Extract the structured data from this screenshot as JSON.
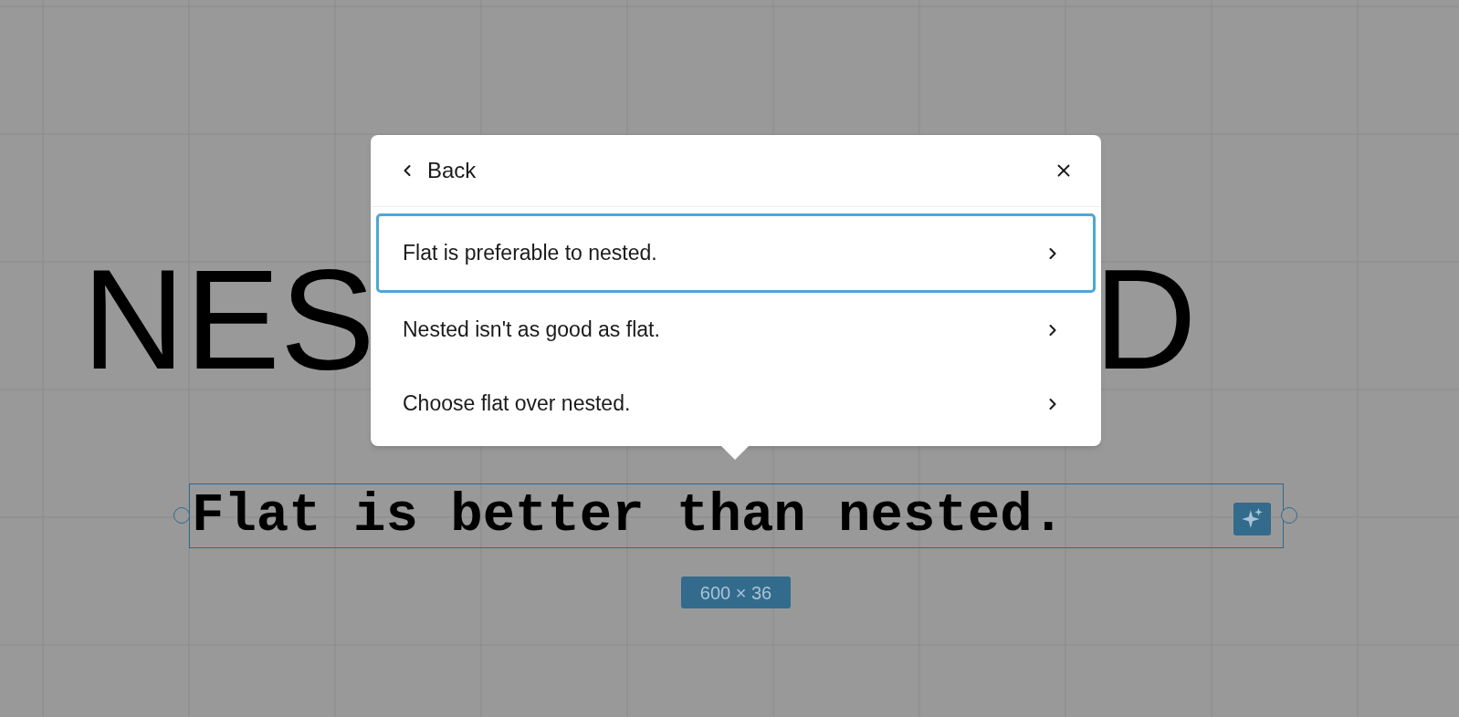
{
  "heading": {
    "left_part": "NES",
    "right_part": "D"
  },
  "popup": {
    "back_label": "Back",
    "options": [
      {
        "label": "Flat is preferable to nested.",
        "selected": true
      },
      {
        "label": "Nested isn't as good as flat.",
        "selected": false
      },
      {
        "label": "Choose flat over nested.",
        "selected": false
      }
    ]
  },
  "text_block": {
    "text": "Flat is better than nested.",
    "size_label": "600 × 36"
  }
}
